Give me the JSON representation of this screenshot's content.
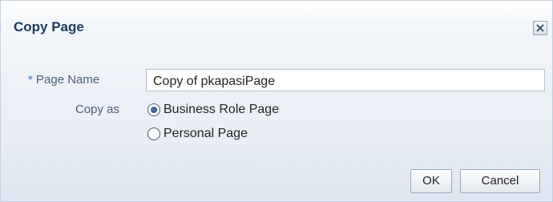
{
  "dialog": {
    "title": "Copy Page",
    "close_icon": "close-icon"
  },
  "form": {
    "required_marker": "*",
    "page_name_label": "Page Name",
    "page_name_value": "Copy of pkapasiPage",
    "copy_as_label": "Copy as",
    "copy_as_options": [
      {
        "label": "Business Role Page",
        "selected": true
      },
      {
        "label": "Personal Page",
        "selected": false
      }
    ]
  },
  "buttons": {
    "ok_label": "OK",
    "cancel_label": "Cancel"
  }
}
